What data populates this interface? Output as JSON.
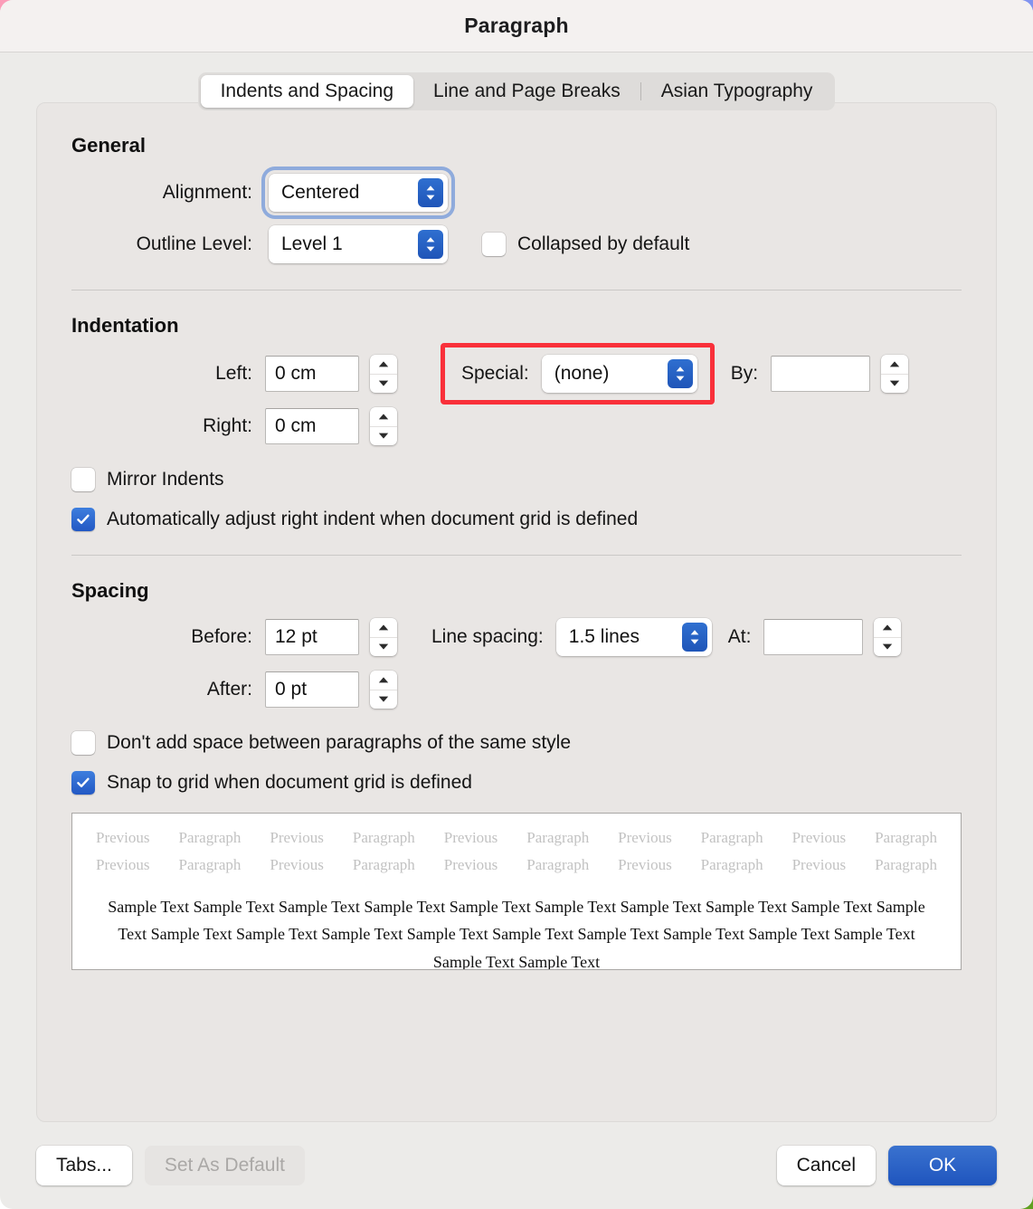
{
  "window": {
    "title": "Paragraph"
  },
  "tabs": [
    {
      "label": "Indents and Spacing",
      "active": true
    },
    {
      "label": "Line and Page Breaks",
      "active": false
    },
    {
      "label": "Asian Typography",
      "active": false
    }
  ],
  "general": {
    "heading": "General",
    "alignment_label": "Alignment:",
    "alignment_value": "Centered",
    "outline_label": "Outline Level:",
    "outline_value": "Level 1",
    "collapsed_label": "Collapsed by default",
    "collapsed_checked": false
  },
  "indentation": {
    "heading": "Indentation",
    "left_label": "Left:",
    "left_value": "0 cm",
    "right_label": "Right:",
    "right_value": "0 cm",
    "special_label": "Special:",
    "special_value": "(none)",
    "by_label": "By:",
    "by_value": "",
    "mirror_label": "Mirror Indents",
    "mirror_checked": false,
    "autoadjust_label": "Automatically adjust right indent when document grid is defined",
    "autoadjust_checked": true
  },
  "spacing": {
    "heading": "Spacing",
    "before_label": "Before:",
    "before_value": "12 pt",
    "after_label": "After:",
    "after_value": "0 pt",
    "linespacing_label": "Line spacing:",
    "linespacing_value": "1.5 lines",
    "at_label": "At:",
    "at_value": "",
    "dontadd_label": "Don't add space between paragraphs of the same style",
    "dontadd_checked": false,
    "snap_label": "Snap to grid when document grid is defined",
    "snap_checked": true
  },
  "preview": {
    "previous_line1": "Previous Paragraph Previous Paragraph Previous Paragraph Previous Paragraph Previous Paragraph",
    "previous_line2": "Previous Paragraph Previous Paragraph Previous Paragraph Previous Paragraph Previous Paragraph",
    "sample_text": "Sample Text Sample Text Sample Text Sample Text Sample Text Sample Text Sample Text Sample Text Sample Text Sample Text Sample Text Sample Text Sample Text Sample Text Sample Text Sample Text Sample Text Sample Text Sample Text Sample Text Sample Text"
  },
  "footer": {
    "tabs_button": "Tabs...",
    "set_default_button": "Set As Default",
    "cancel_button": "Cancel",
    "ok_button": "OK"
  },
  "colors": {
    "accent_blue": "#2258c4",
    "annotation_red": "#f9303a",
    "focus_ring": "#8fabdc",
    "window_bg": "#ecebe9",
    "panel_bg": "#e9e6e4"
  }
}
